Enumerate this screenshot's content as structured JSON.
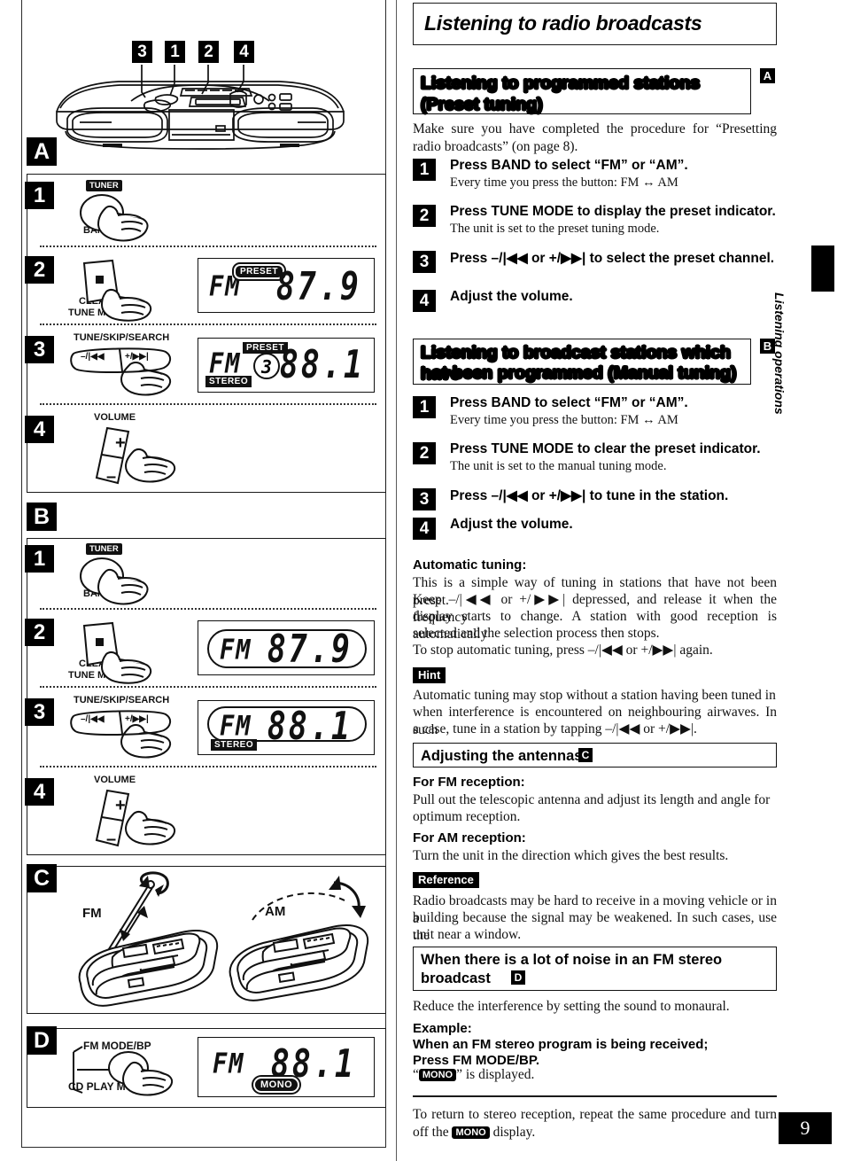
{
  "page": {
    "number": "9",
    "edge_tab_label": "Listening operations"
  },
  "header": {
    "title": "Listening to radio broadcasts"
  },
  "sections": [
    {
      "id": "preset-tuning",
      "heading": "Listening to programmed stations (Preset tuning)",
      "letter": "A",
      "intro": "Make sure you have completed the procedure for “Presetting radio broadcasts” (on page 8).",
      "steps": [
        {
          "num": "1",
          "title": "Press BAND to select “FM” or “AM”.",
          "sub": "Every time you press the button: FM ↔ AM"
        },
        {
          "num": "2",
          "title": "Press TUNE MODE to display the preset indicator.",
          "sub": "The unit is set to the preset tuning mode."
        },
        {
          "num": "3",
          "title": "Press –/|◀◀ or +/▶▶| to select the preset channel.",
          "sub": ""
        },
        {
          "num": "4",
          "title": "Adjust the volume.",
          "sub": ""
        }
      ]
    },
    {
      "id": "manual-tuning",
      "heading_line1": "Listening to broadcast stations which have",
      "heading_line2": "not been programmed (Manual tuning)",
      "letter": "B",
      "steps": [
        {
          "num": "1",
          "title": "Press BAND to select “FM” or “AM”.",
          "sub": "Every time you press the button: FM ↔ AM"
        },
        {
          "num": "2",
          "title": "Press TUNE MODE to clear the preset indicator.",
          "sub": "The unit is set to the manual tuning mode."
        },
        {
          "num": "3",
          "title": "Press –/|◀◀ or +/▶▶| to tune in the station.",
          "sub": ""
        },
        {
          "num": "4",
          "title": "Adjust the volume.",
          "sub": ""
        }
      ]
    }
  ],
  "automatic_tuning": {
    "heading": "Automatic tuning:",
    "body_line1": "This is a simple way of tuning in stations that have not been preset.",
    "body_line2": "Keep –/|◀◀ or +/▶▶| depressed, and release it when the frequency",
    "body_line3": "display starts to change. A station with good reception is automatically",
    "body_line4": "selected and the selection process then stops.",
    "body_line5": "To stop automatic tuning, press –/|◀◀ or +/▶▶| again."
  },
  "hint": {
    "tag": "Hint",
    "body_line1": "Automatic tuning may stop without a station having been tuned in",
    "body_line2": "when interference is encountered on neighbouring airwaves. In such",
    "body_line3": "a case, tune in a station by tapping –/|◀◀ or +/▶▶|."
  },
  "antennas": {
    "heading": "Adjusting the antennas",
    "letter": "C",
    "fm_heading": "For FM reception:",
    "fm_body_line1": "Pull out the telescopic antenna and adjust its length and angle for",
    "fm_body_line2": "optimum reception.",
    "am_heading": "For AM reception:",
    "am_body": "Turn the unit in the direction which gives the best results."
  },
  "reference": {
    "tag": "Reference",
    "body_line1": "Radio broadcasts may be hard to receive in a moving vehicle or in a",
    "body_line2": "building because the signal may be weakened. In such cases, use the",
    "body_line3": "unit near a window."
  },
  "fm_noise": {
    "heading_line1": "When there is a lot of noise in an FM stereo",
    "heading_line2": "broadcast",
    "letter": "D",
    "body": "Reduce the interference by setting the sound to monaural.",
    "example_label": "Example:",
    "example_line1": "When an FM stereo program is being received;",
    "example_line2": "Press FM MODE/BP.",
    "example_line3_pre": "“",
    "example_line3_chip": "MONO",
    "example_line3_post": "” is displayed.",
    "footer_pre": "To return to stereo reception, repeat the same procedure and turn off the ",
    "footer_chip": "MONO",
    "footer_post": " display."
  },
  "illustrations": {
    "top_unit_callouts": [
      "3",
      "1",
      "2",
      "4"
    ],
    "panel_a": {
      "letter": "A",
      "steps": [
        {
          "num": "1",
          "button_top_label": "TUNER",
          "button_bottom_label": "BAND"
        },
        {
          "num": "2",
          "button_label_line1": "CLEAR",
          "button_label_line2": "TUNE MODE"
        },
        {
          "num": "3",
          "button_group_label": "TUNE/SKIP/SEARCH",
          "left_key": "–/|◀◀",
          "right_key": "+/▶▶|"
        },
        {
          "num": "4",
          "button_label": "VOLUME",
          "plus": "+",
          "minus": "–"
        }
      ],
      "lcd_step2": {
        "band": "FM",
        "preset_tag": "PRESET",
        "frequency": "87.9"
      },
      "lcd_step3": {
        "band": "FM",
        "preset_tag": "PRESET",
        "channel": "3",
        "frequency": "88.1",
        "stereo_tag": "STEREO"
      }
    },
    "panel_b": {
      "letter": "B",
      "steps": [
        {
          "num": "1",
          "button_top_label": "TUNER",
          "button_bottom_label": "BAND"
        },
        {
          "num": "2",
          "button_label_line1": "CLEAR",
          "button_label_line2": "TUNE MODE"
        },
        {
          "num": "3",
          "button_group_label": "TUNE/SKIP/SEARCH",
          "left_key": "–/|◀◀",
          "right_key": "+/▶▶|"
        },
        {
          "num": "4",
          "button_label": "VOLUME",
          "plus": "+",
          "minus": "–"
        }
      ],
      "lcd_step2": {
        "band": "FM",
        "frequency": "87.9"
      },
      "lcd_step3": {
        "band": "FM",
        "frequency": "88.1",
        "stereo_tag": "STEREO"
      }
    },
    "panel_c": {
      "letter": "C",
      "fm_label": "FM",
      "am_label": "AM"
    },
    "panel_d": {
      "letter": "D",
      "button_label_top": "FM MODE/BP",
      "button_label_bottom": "CD PLAY MODE",
      "lcd": {
        "band": "FM",
        "frequency": "88.1",
        "mono_tag": "MONO"
      }
    }
  }
}
